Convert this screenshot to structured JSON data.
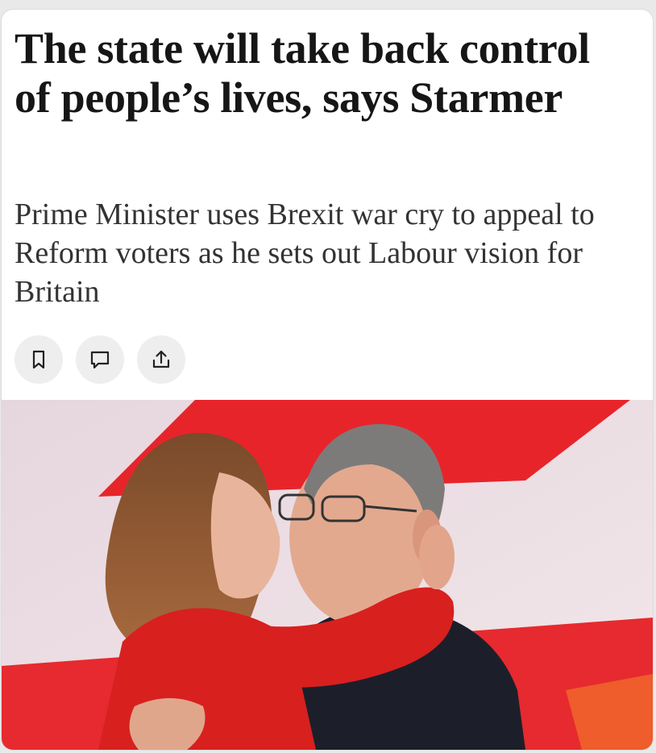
{
  "article": {
    "headline": "The state will take back control of people’s lives, says Starmer",
    "standfirst": "Prime Minister uses Brexit war cry to appeal to Reform voters as he sets out Labour vision for Britain"
  },
  "actions": [
    {
      "icon": "bookmark-icon"
    },
    {
      "icon": "comment-icon"
    },
    {
      "icon": "share-icon"
    }
  ],
  "colors": {
    "headline": "#161616",
    "standfirst": "#333333",
    "button_bg": "#eeeeee",
    "icon_stroke": "#222222",
    "backdrop_red": "#e8242b",
    "backdrop_pink": "#ecdce2"
  }
}
